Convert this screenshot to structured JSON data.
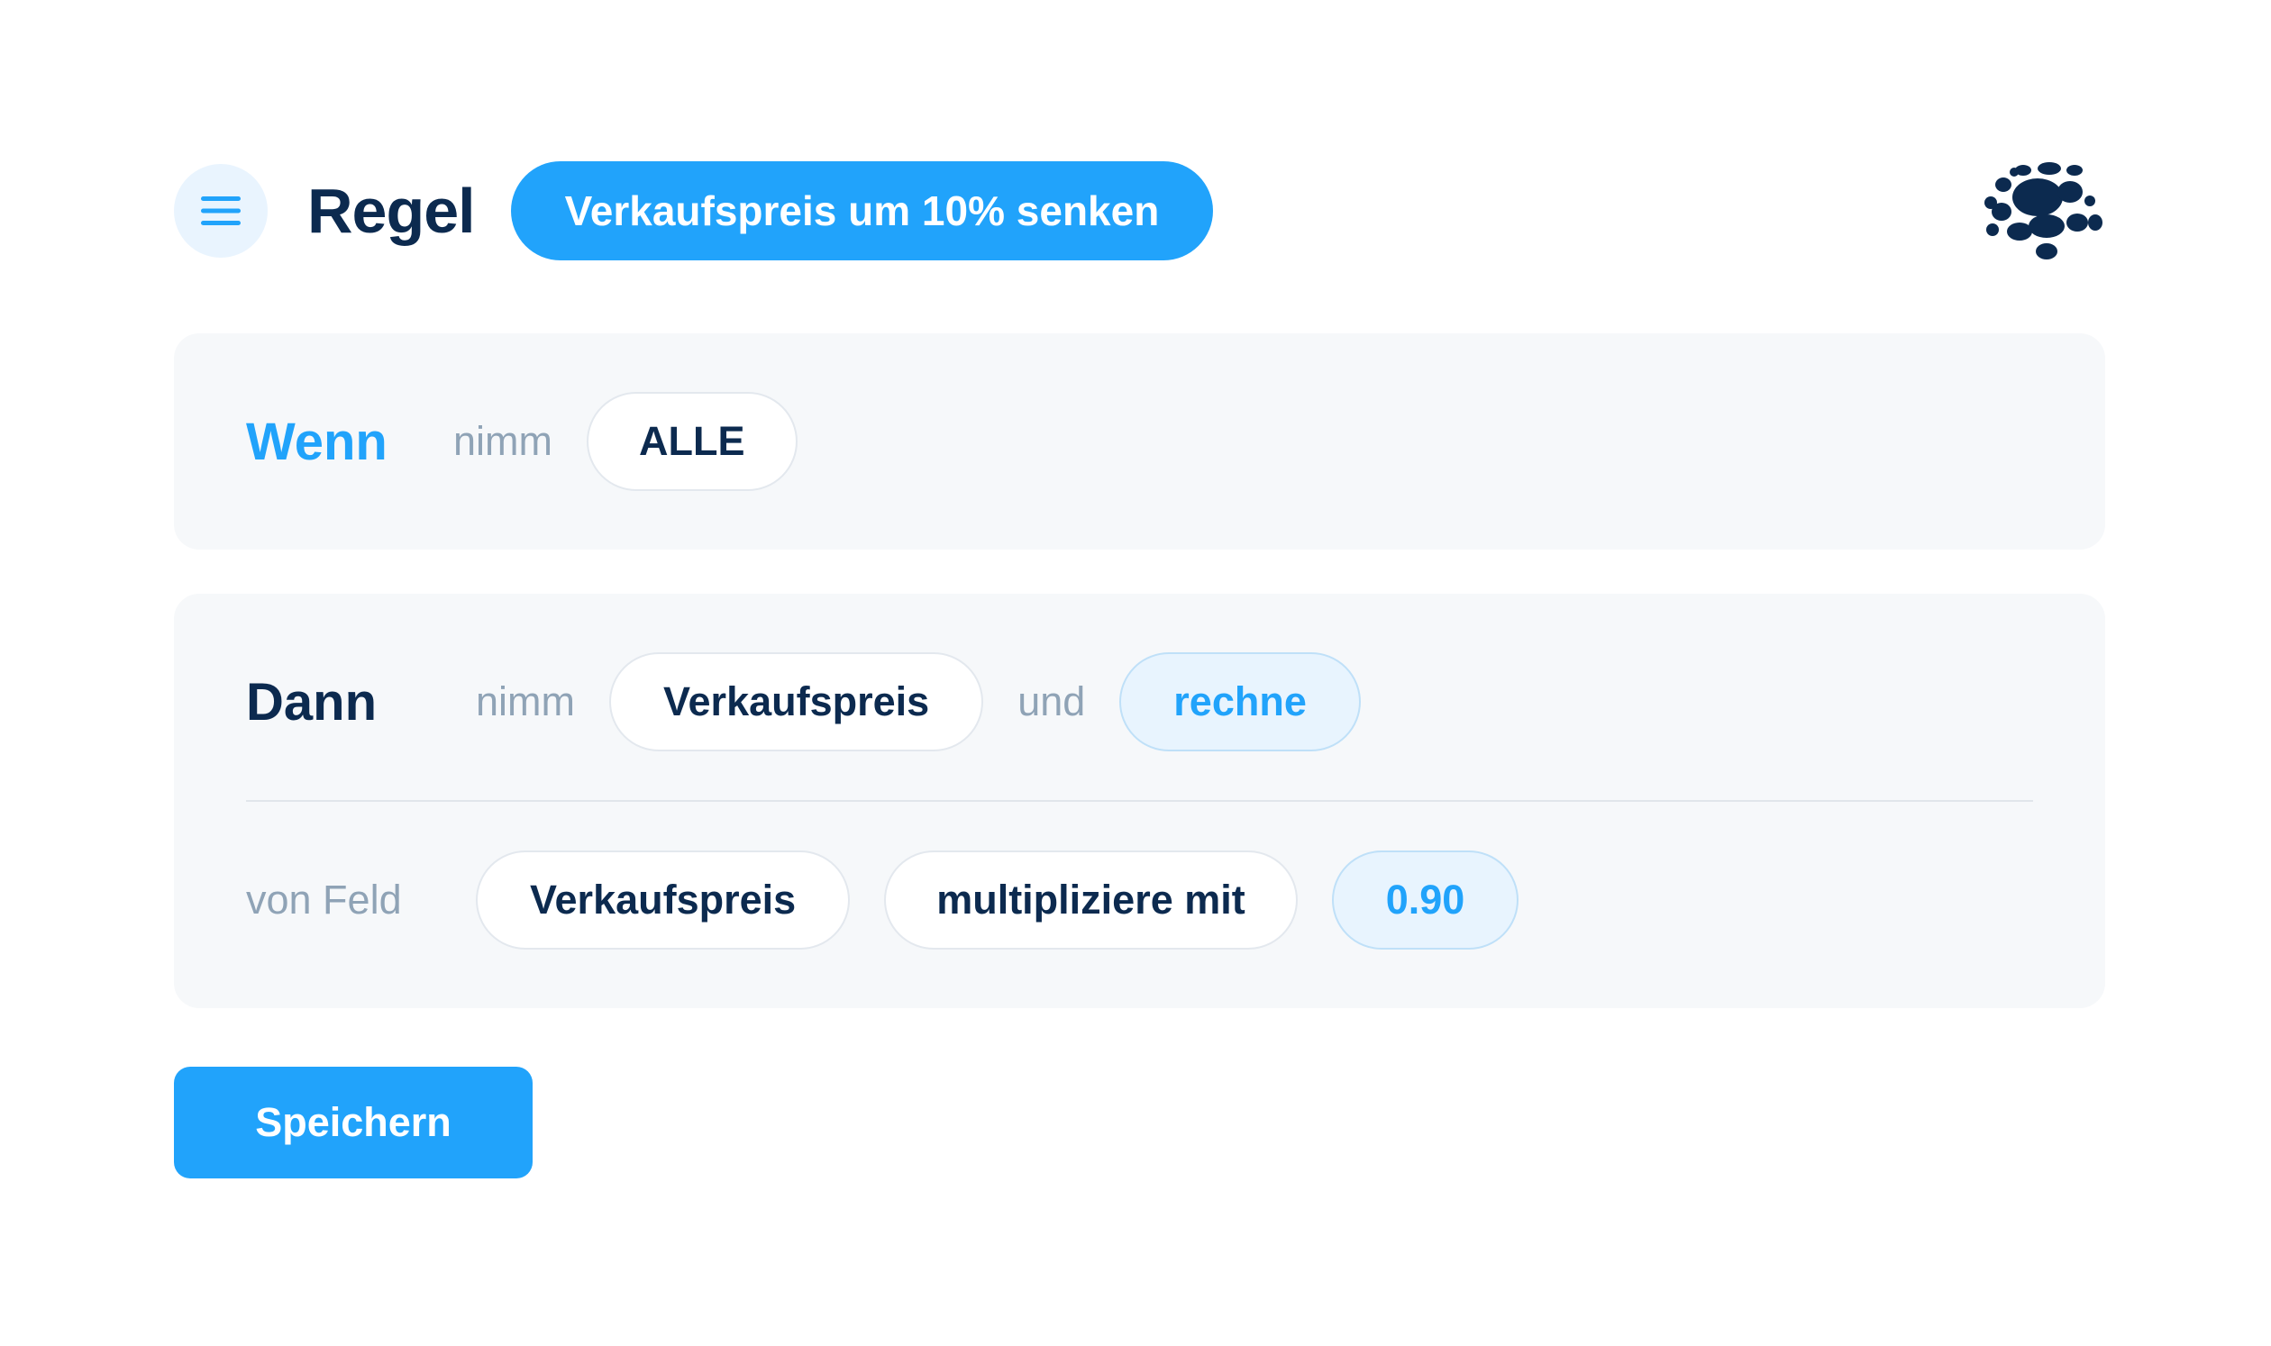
{
  "header": {
    "title": "Regel",
    "rule_name": "Verkaufspreis um 10% senken"
  },
  "condition": {
    "keyword": "Wenn",
    "take_label": "nimm",
    "scope_value": "ALLE"
  },
  "action": {
    "keyword": "Dann",
    "take_label": "nimm",
    "target_field": "Verkaufspreis",
    "and_label": "und",
    "operation_mode": "rechne",
    "from_field_label": "von Feld",
    "source_field": "Verkaufspreis",
    "operator": "multipliziere mit",
    "operand": "0.90"
  },
  "footer": {
    "save_label": "Speichern"
  },
  "colors": {
    "accent": "#21a3fb",
    "navy": "#0c2a4f",
    "muted": "#8fa3b6",
    "card_bg": "#f6f8fa",
    "accent_light": "#e8f4fe"
  },
  "icons": {
    "menu": "hamburger-icon",
    "logo": "dotted-globe-logo"
  }
}
